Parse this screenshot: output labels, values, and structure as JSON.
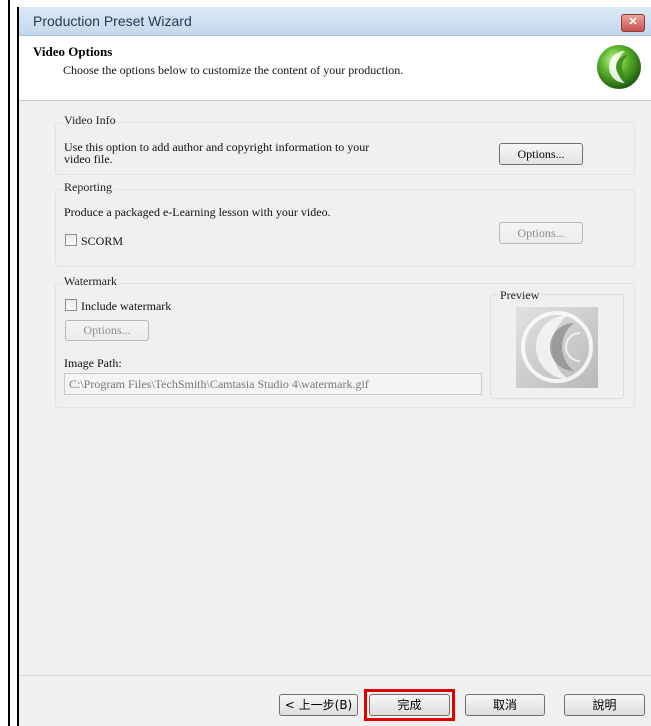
{
  "window": {
    "title": "Production Preset Wizard",
    "close_icon": "close-icon"
  },
  "header": {
    "title": "Video Options",
    "subtitle": "Choose the options below to customize the content of your production."
  },
  "video_info": {
    "label": "Video Info",
    "description_line1": "Use this option to add author and copyright information to your",
    "description_line2": "video file.",
    "options_button": "Options..."
  },
  "reporting": {
    "label": "Reporting",
    "description": "Produce a packaged  e-Learning lesson with your video.",
    "scorm_label": "SCORM",
    "scorm_checked": false,
    "options_button": "Options..."
  },
  "watermark": {
    "label": "Watermark",
    "include_label": "Include watermark",
    "include_checked": false,
    "options_button": "Options...",
    "image_path_label": "Image Path:",
    "image_path_value": "C:\\Program Files\\TechSmith\\Camtasia Studio 4\\watermark.gif",
    "preview_label": "Preview"
  },
  "footer": {
    "back_button": "< 上一步(B)",
    "finish_button": "完成",
    "cancel_button": "取消",
    "help_button": "說明"
  },
  "colors": {
    "highlight": "#e00000",
    "title_text": "#1e395b"
  }
}
